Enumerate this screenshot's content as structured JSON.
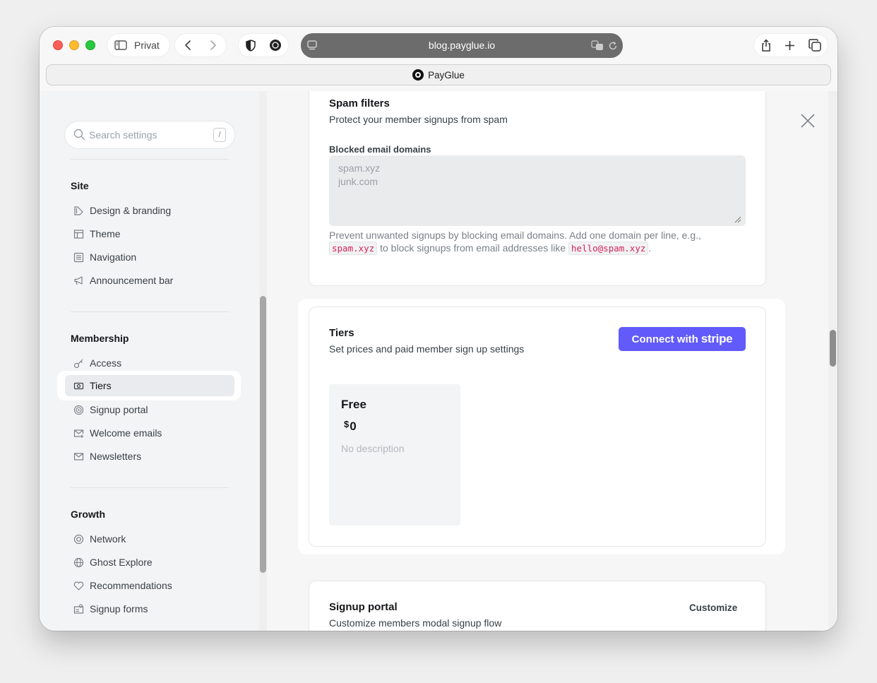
{
  "browser": {
    "sidebar_toggle_label": "Privat",
    "url": "blog.payglue.io",
    "tab_title": "PayGlue"
  },
  "search": {
    "placeholder": "Search settings",
    "shortcut": "/"
  },
  "sidebar": {
    "site": {
      "title": "Site",
      "items": [
        {
          "label": "Design & branding",
          "icon": "brush-icon"
        },
        {
          "label": "Theme",
          "icon": "layout-icon"
        },
        {
          "label": "Navigation",
          "icon": "list-icon"
        },
        {
          "label": "Announcement bar",
          "icon": "megaphone-icon"
        }
      ]
    },
    "membership": {
      "title": "Membership",
      "items": [
        {
          "label": "Access",
          "icon": "key-icon"
        },
        {
          "label": "Tiers",
          "icon": "money-icon"
        },
        {
          "label": "Signup portal",
          "icon": "portal-icon"
        },
        {
          "label": "Welcome emails",
          "icon": "mail-plus-icon"
        },
        {
          "label": "Newsletters",
          "icon": "mail-icon"
        }
      ]
    },
    "growth": {
      "title": "Growth",
      "items": [
        {
          "label": "Network",
          "icon": "network-icon"
        },
        {
          "label": "Ghost Explore",
          "icon": "globe-icon"
        },
        {
          "label": "Recommendations",
          "icon": "heart-icon"
        },
        {
          "label": "Signup forms",
          "icon": "form-icon"
        }
      ]
    }
  },
  "spam": {
    "title": "Spam filters",
    "subtitle": "Protect your member signups from spam",
    "field_label": "Blocked email domains",
    "placeholder": "spam.xyz\njunk.com",
    "hint_before": "Prevent unwanted signups by blocking email domains. Add one domain per line, e.g.,",
    "hint_code1": "spam.xyz",
    "hint_middle": "to block signups from email addresses like",
    "hint_code2": "hello@spam.xyz",
    "hint_end": "."
  },
  "tiers": {
    "title": "Tiers",
    "subtitle": "Set prices and paid member sign up settings",
    "connect_label": "Connect with",
    "connect_brand": "stripe",
    "tier": {
      "name": "Free",
      "currency": "$",
      "amount": "0",
      "description": "No description"
    }
  },
  "portal": {
    "title": "Signup portal",
    "subtitle": "Customize members modal signup flow",
    "customize_label": "Customize"
  }
}
